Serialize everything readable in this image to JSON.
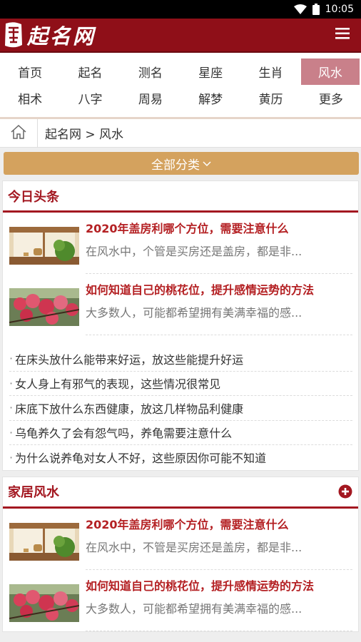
{
  "status_bar": {
    "time": "10:05"
  },
  "app_bar": {
    "logo_text": "起名网"
  },
  "nav": {
    "row1": [
      {
        "label": "首页",
        "active": false
      },
      {
        "label": "起名",
        "active": false
      },
      {
        "label": "测名",
        "active": false
      },
      {
        "label": "星座",
        "active": false
      },
      {
        "label": "生肖",
        "active": false
      },
      {
        "label": "风水",
        "active": true
      }
    ],
    "row2": [
      {
        "label": "相术"
      },
      {
        "label": "八字"
      },
      {
        "label": "周易"
      },
      {
        "label": "解梦"
      },
      {
        "label": "黄历"
      },
      {
        "label": "更多"
      }
    ]
  },
  "breadcrumb": {
    "text": "起名网 > 风水"
  },
  "category": {
    "label": "全部分类"
  },
  "sections": {
    "today": {
      "title": "今日头条",
      "articles": [
        {
          "title": "2020年盖房利哪个方位，需要注意什么",
          "desc": "在风水中，个管是买房还是盖房，都是非..."
        },
        {
          "title": "如何知道自己的桃花位，提升感情运势的方法",
          "desc": "大多数人，可能都希望拥有美满幸福的感..."
        }
      ],
      "links": [
        "在床头放什么能带来好运，放这些能提升好运",
        "女人身上有邪气的表现，这些情况很常见",
        "床底下放什么东西健康，放这几样物品利健康",
        "乌龟养久了会有怨气吗，养龟需要注意什么",
        "为什么说养龟对女人不好，这些原因你可能不知道"
      ]
    },
    "home": {
      "title": "家居风水",
      "articles": [
        {
          "title": "2020年盖房利哪个方位，需要注意什么",
          "desc": "在风水中，不管是买房还是盖房，都是非..."
        },
        {
          "title": "如何知道自己的桃花位，提升感情运势的方法",
          "desc": "大多数人，可能都希望拥有美满幸福的感..."
        }
      ]
    }
  },
  "colors": {
    "brand": "#8f0f18",
    "accent": "#a31720",
    "category_bar": "#d4a25e",
    "active_tab": "#c9808a"
  },
  "icons": [
    "wifi-icon",
    "battery-icon",
    "menu-icon",
    "home-icon",
    "chevron-down-icon",
    "plus-circle-icon"
  ]
}
